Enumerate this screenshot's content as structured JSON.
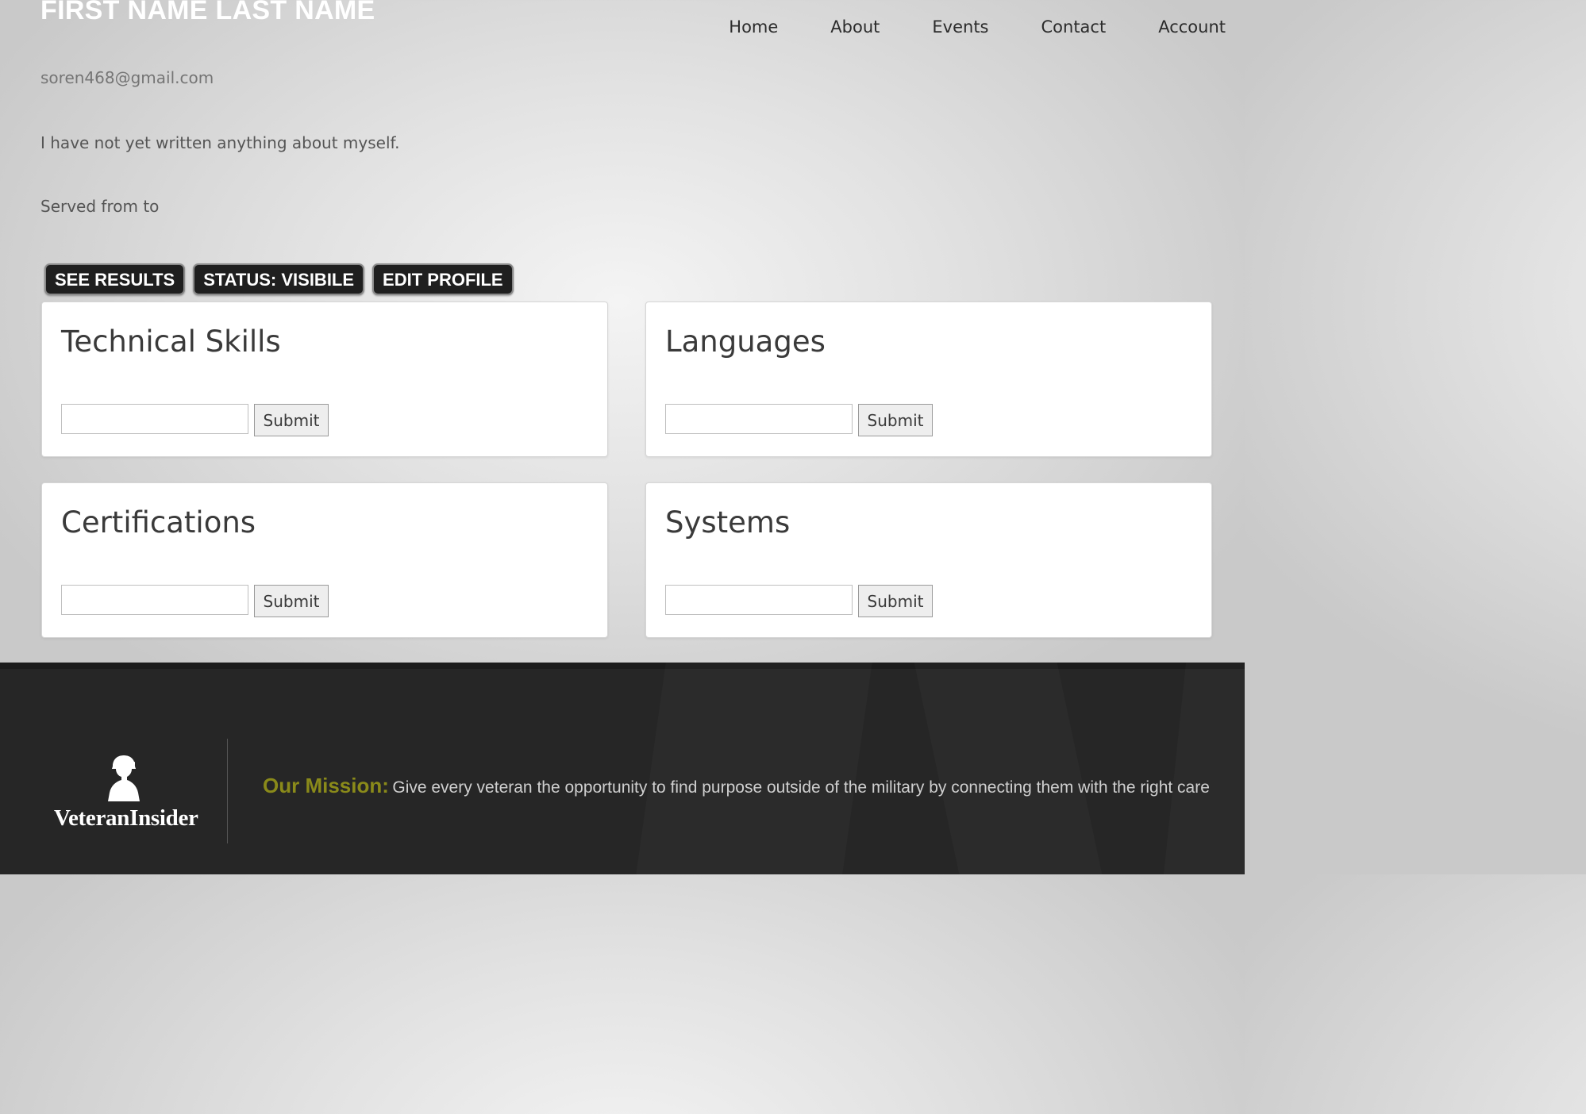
{
  "profile": {
    "name": "FIRST NAME LAST NAME",
    "email": "soren468@gmail.com",
    "about": "I have not yet written anything about myself.",
    "served": "Served from to"
  },
  "nav": {
    "items": [
      {
        "label": "Home"
      },
      {
        "label": "About"
      },
      {
        "label": "Events"
      },
      {
        "label": "Contact"
      },
      {
        "label": "Account"
      }
    ]
  },
  "actions": {
    "see_results": "SEE RESULTS",
    "status": "STATUS: VISIBILE",
    "edit_profile": "EDIT PROFILE"
  },
  "cards": [
    {
      "title": "Technical Skills",
      "input_value": "",
      "submit_label": "Submit"
    },
    {
      "title": "Languages",
      "input_value": "",
      "submit_label": "Submit"
    },
    {
      "title": "Certifications",
      "input_value": "",
      "submit_label": "Submit"
    },
    {
      "title": "Systems",
      "input_value": "",
      "submit_label": "Submit"
    }
  ],
  "footer": {
    "logo_text": "VeteranInsider",
    "logo_icon": "soldier-silhouette-icon",
    "mission_label": "Our Mission:",
    "mission_text": "Give every veteran the opportunity to find purpose outside of the military by connecting them with the right care"
  },
  "colors": {
    "mission_accent": "#8a8a1a",
    "footer_bg": "#262626",
    "pill_bg": "#1f1f1f"
  }
}
